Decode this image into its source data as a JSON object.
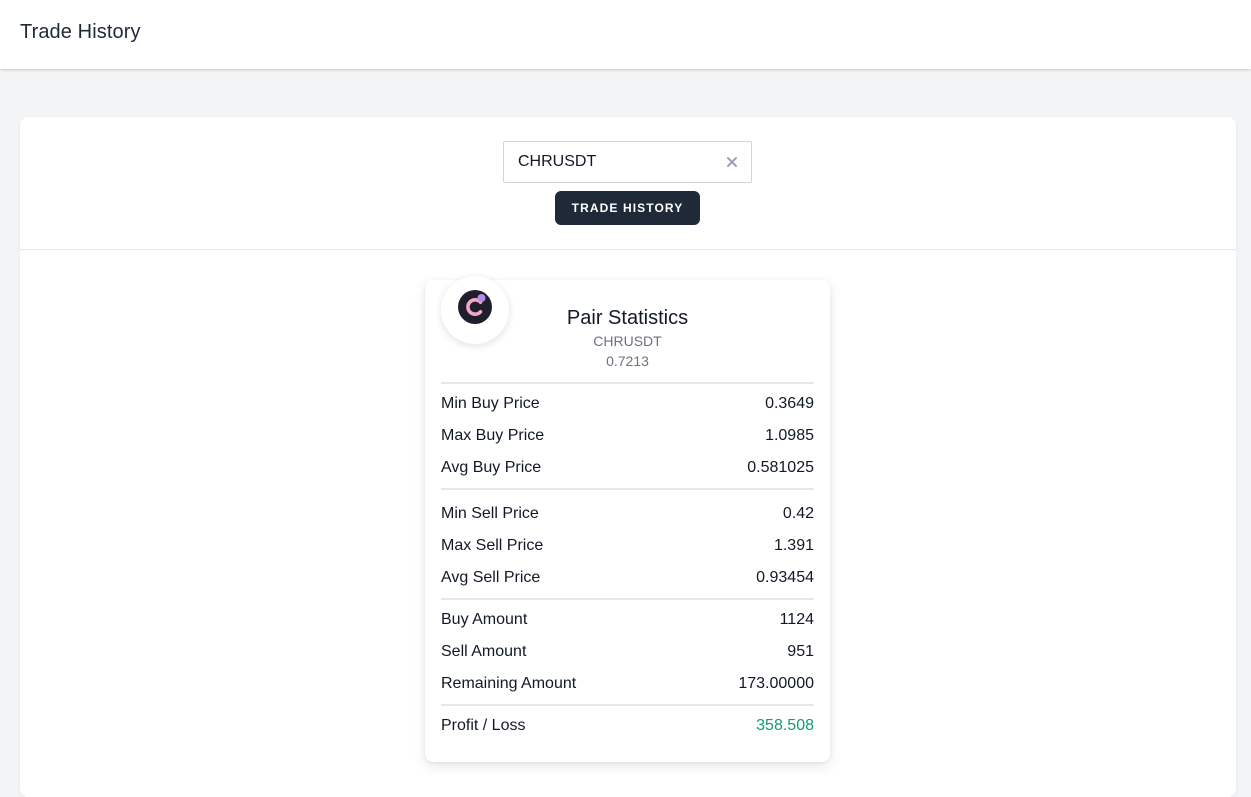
{
  "header": {
    "title": "Trade History"
  },
  "search": {
    "value": "CHRUSDT",
    "clear_icon": "close-icon",
    "button_label": "Trade History"
  },
  "stats": {
    "logo_icon": "chromia-coin-icon",
    "title": "Pair Statistics",
    "symbol": "CHRUSDT",
    "current_price": "0.7213",
    "buy": [
      {
        "label": "Min Buy Price",
        "value": "0.3649"
      },
      {
        "label": "Max Buy Price",
        "value": "1.0985"
      },
      {
        "label": "Avg Buy Price",
        "value": "0.581025"
      }
    ],
    "sell": [
      {
        "label": "Min Sell Price",
        "value": "0.42"
      },
      {
        "label": "Max Sell Price",
        "value": "1.391"
      },
      {
        "label": "Avg Sell Price",
        "value": "0.93454"
      }
    ],
    "amounts": [
      {
        "label": "Buy Amount",
        "value": "1124"
      },
      {
        "label": "Sell Amount",
        "value": "951"
      },
      {
        "label": "Remaining Amount",
        "value": "173.00000"
      }
    ],
    "profit": {
      "label": "Profit / Loss",
      "value": "358.508"
    }
  },
  "colors": {
    "primary_button": "#1f2937",
    "profit": "#139c74",
    "muted_text": "#6b7280"
  }
}
